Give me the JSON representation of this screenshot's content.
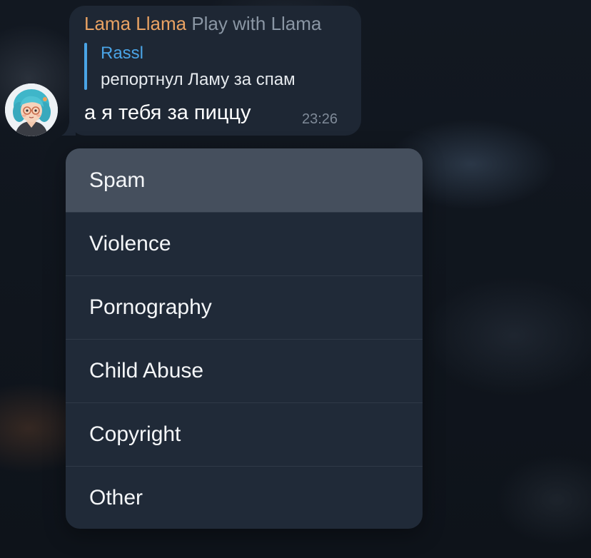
{
  "message": {
    "sender_name": "Lama Llama",
    "via_bot": "Play with Llama",
    "reply_author": "Rassl",
    "reply_text": "репортнул Ламу за спам",
    "text": "а я тебя за пиццу",
    "time": "23:26",
    "colors": {
      "sender": "#e9a263",
      "reply_accent": "#4aa4e6",
      "bubble": "#1e2734"
    }
  },
  "avatar": {
    "icon": "user-avatar-illustration"
  },
  "report_menu": {
    "items": [
      {
        "label": "Spam",
        "highlighted": true
      },
      {
        "label": "Violence"
      },
      {
        "label": "Pornography"
      },
      {
        "label": "Child Abuse"
      },
      {
        "label": "Copyright"
      },
      {
        "label": "Other"
      }
    ]
  }
}
